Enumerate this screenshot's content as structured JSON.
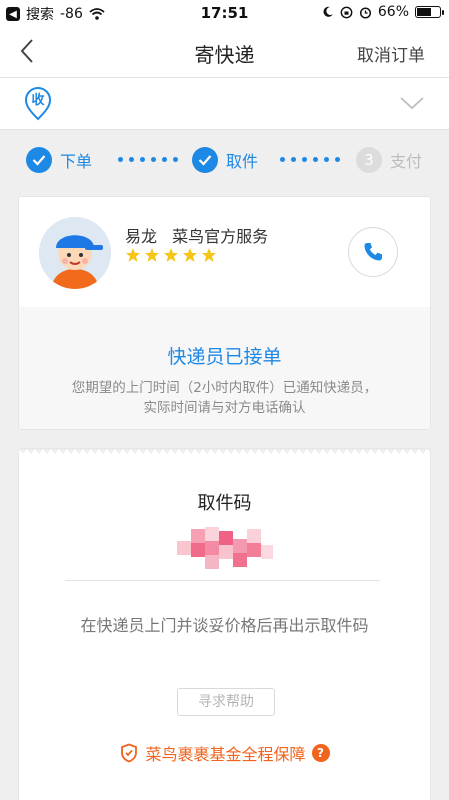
{
  "status_bar": {
    "app_back": "搜索",
    "signal": "-86",
    "time": "17:51",
    "battery": "66%",
    "battery_level": 0.66
  },
  "nav": {
    "title": "寄快递",
    "cancel": "取消订单"
  },
  "address": {
    "badge": "收"
  },
  "steps": [
    {
      "label": "下单",
      "done": true
    },
    {
      "label": "取件",
      "done": true
    },
    {
      "num": "3",
      "label": "支付",
      "done": false
    }
  ],
  "courier": {
    "name": "易龙",
    "service": "菜鸟官方服务",
    "rating": 5,
    "status_title": "快递员已接单",
    "notice_line1": "您期望的上门时间（2小时内取件）已通知快递员，",
    "notice_line2": "实际时间请与对方电话确认"
  },
  "pickup": {
    "title": "取件码",
    "hint": "在快递员上门并谈妥价格后再出示取件码",
    "help_button": "寻求帮助",
    "guarantee": "菜鸟裹裹基金全程保障",
    "guarantee_help": "?"
  },
  "colors": {
    "primary": "#1e88e5",
    "accent": "#f0641e",
    "star": "#f5c518"
  }
}
